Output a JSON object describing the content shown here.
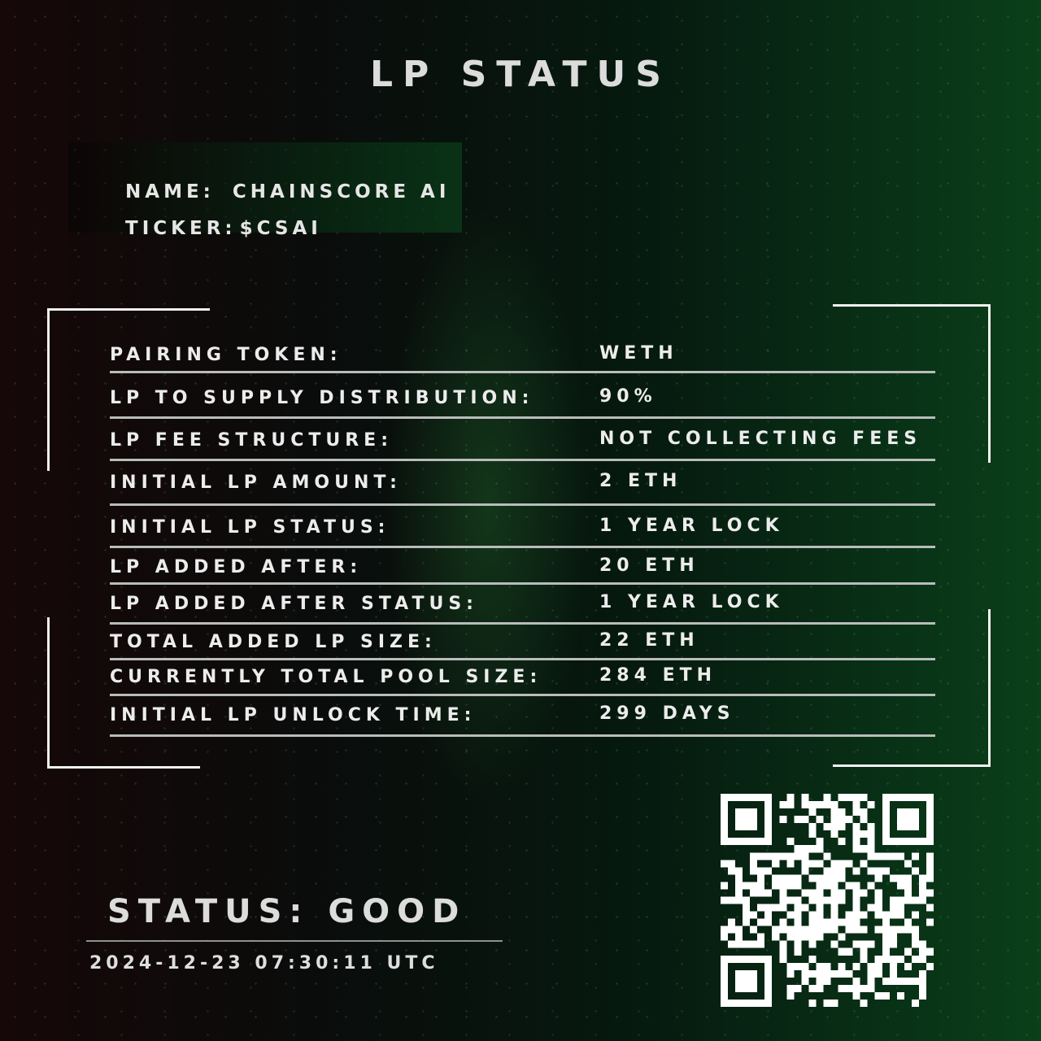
{
  "title": "LP STATUS",
  "token": {
    "name_label": "NAME:",
    "name_value": "CHAINSCORE AI",
    "ticker_label": "TICKER:",
    "ticker_value": "$CSAI"
  },
  "rows": [
    {
      "label": "PAIRING TOKEN:",
      "value": "WETH"
    },
    {
      "label": "LP TO SUPPLY DISTRIBUTION:",
      "value": "90%"
    },
    {
      "label": "LP FEE STRUCTURE:",
      "value": "NOT COLLECTING FEES"
    },
    {
      "label": "INITIAL LP AMOUNT:",
      "value": "2 ETH"
    },
    {
      "label": "INITIAL LP STATUS:",
      "value": "1 YEAR LOCK"
    },
    {
      "label": "LP ADDED AFTER:",
      "value": "20 ETH"
    },
    {
      "label": "LP ADDED AFTER STATUS:",
      "value": "1 YEAR LOCK"
    },
    {
      "label": "TOTAL ADDED LP SIZE:",
      "value": "22 ETH"
    },
    {
      "label": "CURRENTLY TOTAL POOL SIZE:",
      "value": "284 ETH"
    },
    {
      "label": "INITIAL LP UNLOCK TIME:",
      "value": "299 DAYS"
    }
  ],
  "status": "STATUS: GOOD",
  "timestamp": "2024-12-23 07:30:11 UTC",
  "colors": {
    "accent_green": "#0a3f1a",
    "text": "#e6e6e6",
    "qr": "#ffffff"
  },
  "icons": [
    "qr-code-icon"
  ]
}
